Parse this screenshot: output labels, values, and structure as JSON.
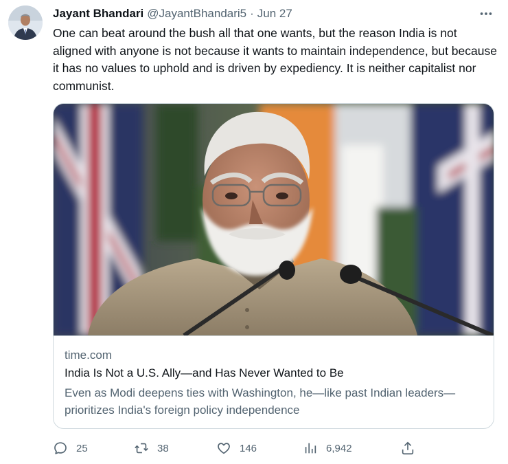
{
  "tweet": {
    "author": {
      "display_name": "Jayant Bhandari",
      "handle": "@JayantBhandari5",
      "separator": "·",
      "date": "Jun 27"
    },
    "text": "One can beat around the bush all that one wants, but the reason India is not aligned with anyone is not because it wants to maintain independence, but because it has no values to uphold and is driven by expediency. It is neither capitalist nor communist.",
    "more_icon": "more-horizontal-icon"
  },
  "card": {
    "domain": "time.com",
    "title": "India Is Not a U.S. Ally—and Has Never Wanted to Be",
    "description": "Even as Modi deepens ties with Washington, he—like past Indian leaders—prioritizes India's foreign policy independence"
  },
  "actions": {
    "reply": {
      "icon": "reply-icon",
      "count": "25"
    },
    "retweet": {
      "icon": "retweet-icon",
      "count": "38"
    },
    "like": {
      "icon": "heart-icon",
      "count": "146"
    },
    "views": {
      "icon": "views-bar-chart-icon",
      "count": "6,942"
    },
    "share": {
      "icon": "share-icon"
    }
  },
  "colors": {
    "text_primary": "#0f1419",
    "text_secondary": "#536471",
    "border": "#cfd9de",
    "background": "#ffffff"
  }
}
